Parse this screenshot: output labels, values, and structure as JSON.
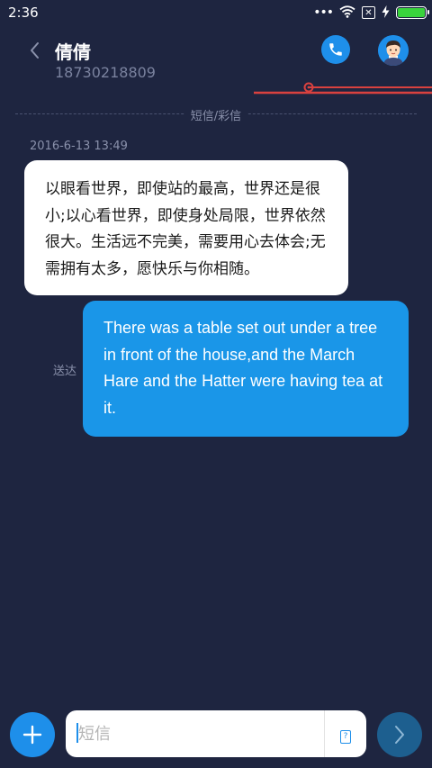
{
  "status_bar": {
    "time": "2:36",
    "dots": "•••",
    "sim_icon_glyph": "✕",
    "battery_level": 1.0
  },
  "header": {
    "contact_name": "倩倩",
    "contact_number": "18730218809"
  },
  "divider": {
    "label": "短信/彩信"
  },
  "conversation": {
    "timestamp": "2016-6-13 13:49",
    "incoming_message": "以眼看世界，即使站的最高，世界还是很小;以心看世界，即使身处局限，世界依然很大。生活远不完美，需要用心去体会;无需拥有太多，愿快乐与你相随。",
    "outgoing_message": "There was a table set out under a tree in front of the house,and the March Hare and the Hatter were having tea at it.",
    "outgoing_status": "送达"
  },
  "composer": {
    "placeholder": "短信",
    "sim_glyph": "?"
  },
  "colors": {
    "background": "#1e2540",
    "accent": "#1e8fea",
    "outgoing_bubble": "#1a96e8",
    "incoming_bubble": "#ffffff",
    "battery": "#39d33c",
    "decor_red": "#d9413f"
  },
  "icons": {
    "back": "chevron-left-icon",
    "call": "phone-icon",
    "avatar": "avatar-icon",
    "add": "plus-icon",
    "send": "chevron-right-icon",
    "wifi": "wifi-icon",
    "charging": "lightning-icon"
  }
}
